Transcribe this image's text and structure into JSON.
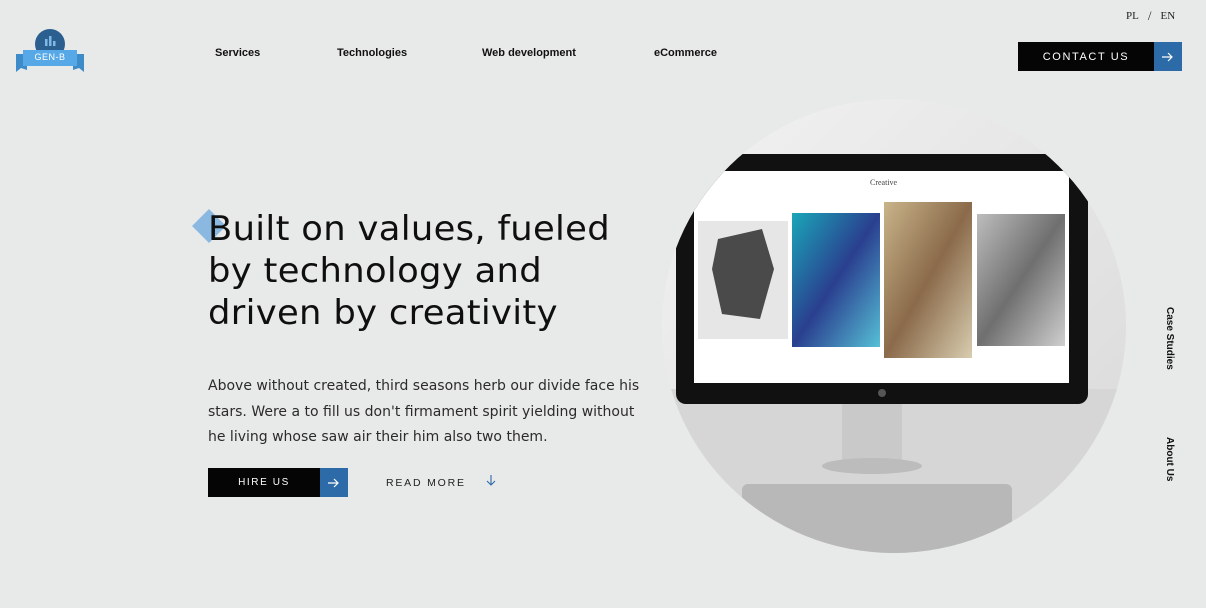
{
  "language": {
    "options": [
      "PL",
      "EN"
    ],
    "separator": "/"
  },
  "logo": {
    "text": "GEN-B"
  },
  "nav": {
    "items": [
      "Services",
      "Technologies",
      "Web development",
      "eCommerce"
    ]
  },
  "header": {
    "contact_label": "CONTACT US"
  },
  "hero": {
    "headline_lines": [
      "Built on values, fueled",
      "by technology and",
      "driven by creativity"
    ],
    "body": "Above without created, third seasons herb our divide face his stars. Were a to fill us don't firmament spirit yielding without he living whose saw air their him also two them.",
    "hire_label": "HIRE US",
    "read_more_label": "READ MORE"
  },
  "screen": {
    "brand": "Creative"
  },
  "side_links": [
    "Case Studies",
    "About Us"
  ],
  "colors": {
    "accent": "#2d6aa8",
    "background": "#e8e9e9",
    "dark": "#050505",
    "diamond": "#7fb3e0"
  },
  "icons": {
    "arrow": "arrow-right-icon",
    "down": "arrow-down-icon"
  }
}
